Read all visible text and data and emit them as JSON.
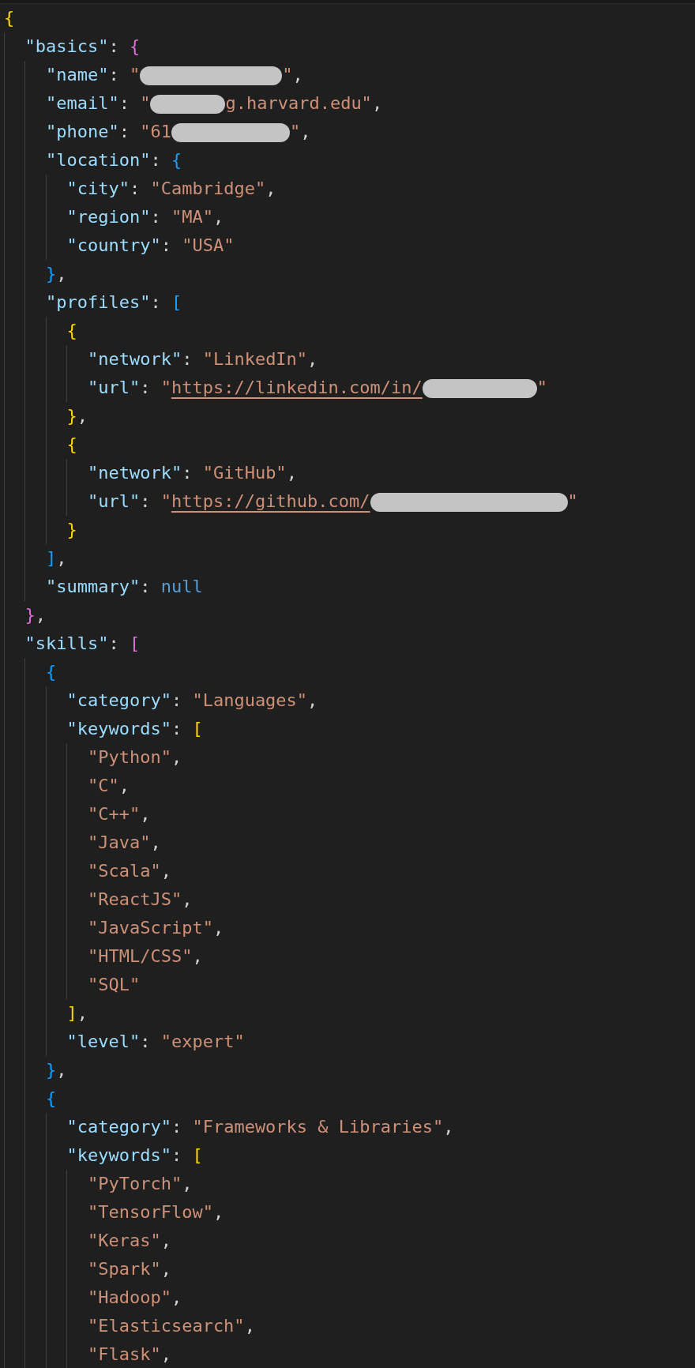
{
  "editor": {
    "lines": [
      {
        "tokens": [
          {
            "kind": "bracket",
            "text": "{",
            "color": "#ffd700"
          }
        ],
        "children": [
          {
            "tokens": [
              {
                "kind": "key",
                "text": "\"basics\""
              },
              {
                "kind": "punct",
                "text": ": "
              },
              {
                "kind": "bracket",
                "text": "{",
                "color": "#da70d6"
              }
            ],
            "children": [
              {
                "tokens": [
                  {
                    "kind": "key",
                    "text": "\"name\""
                  },
                  {
                    "kind": "punct",
                    "text": ": "
                  },
                  {
                    "kind": "string",
                    "text": "\""
                  },
                  {
                    "kind": "redacted"
                  },
                  {
                    "kind": "string",
                    "text": "\""
                  },
                  {
                    "kind": "punct",
                    "text": ","
                  }
                ]
              },
              {
                "tokens": [
                  {
                    "kind": "key",
                    "text": "\"email\""
                  },
                  {
                    "kind": "punct",
                    "text": ": "
                  },
                  {
                    "kind": "string",
                    "text": "\""
                  },
                  {
                    "kind": "redacted"
                  },
                  {
                    "kind": "string",
                    "text": "g.harvard.edu\""
                  },
                  {
                    "kind": "punct",
                    "text": ","
                  }
                ]
              },
              {
                "tokens": [
                  {
                    "kind": "key",
                    "text": "\"phone\""
                  },
                  {
                    "kind": "punct",
                    "text": ": "
                  },
                  {
                    "kind": "string",
                    "text": "\"61"
                  },
                  {
                    "kind": "redacted"
                  },
                  {
                    "kind": "string",
                    "text": "\""
                  },
                  {
                    "kind": "punct",
                    "text": ","
                  }
                ]
              },
              {
                "tokens": [
                  {
                    "kind": "key",
                    "text": "\"location\""
                  },
                  {
                    "kind": "punct",
                    "text": ": "
                  },
                  {
                    "kind": "bracket",
                    "text": "{",
                    "color": "#179fff"
                  }
                ],
                "children": [
                  {
                    "tokens": [
                      {
                        "kind": "key",
                        "text": "\"city\""
                      },
                      {
                        "kind": "punct",
                        "text": ": "
                      },
                      {
                        "kind": "string",
                        "text": "\"Cambridge\""
                      },
                      {
                        "kind": "punct",
                        "text": ","
                      }
                    ]
                  },
                  {
                    "tokens": [
                      {
                        "kind": "key",
                        "text": "\"region\""
                      },
                      {
                        "kind": "punct",
                        "text": ": "
                      },
                      {
                        "kind": "string",
                        "text": "\"MA\""
                      },
                      {
                        "kind": "punct",
                        "text": ","
                      }
                    ]
                  },
                  {
                    "tokens": [
                      {
                        "kind": "key",
                        "text": "\"country\""
                      },
                      {
                        "kind": "punct",
                        "text": ": "
                      },
                      {
                        "kind": "string",
                        "text": "\"USA\""
                      }
                    ]
                  }
                ]
              },
              {
                "tokens": [
                  {
                    "kind": "bracket",
                    "text": "}",
                    "color": "#179fff"
                  },
                  {
                    "kind": "punct",
                    "text": ","
                  }
                ]
              },
              {
                "tokens": [
                  {
                    "kind": "key",
                    "text": "\"profiles\""
                  },
                  {
                    "kind": "punct",
                    "text": ": "
                  },
                  {
                    "kind": "bracket",
                    "text": "[",
                    "color": "#179fff"
                  }
                ],
                "children": [
                  {
                    "tokens": [
                      {
                        "kind": "bracket",
                        "text": "{",
                        "color": "#ffd700"
                      }
                    ],
                    "children": [
                      {
                        "tokens": [
                          {
                            "kind": "key",
                            "text": "\"network\""
                          },
                          {
                            "kind": "punct",
                            "text": ": "
                          },
                          {
                            "kind": "string",
                            "text": "\"LinkedIn\""
                          },
                          {
                            "kind": "punct",
                            "text": ","
                          }
                        ]
                      },
                      {
                        "tokens": [
                          {
                            "kind": "key",
                            "text": "\"url\""
                          },
                          {
                            "kind": "punct",
                            "text": ": "
                          },
                          {
                            "kind": "string",
                            "text": "\""
                          },
                          {
                            "kind": "link",
                            "text": "https://linkedin.com/in/"
                          },
                          {
                            "kind": "redacted"
                          },
                          {
                            "kind": "string",
                            "text": "\""
                          }
                        ]
                      }
                    ]
                  },
                  {
                    "tokens": [
                      {
                        "kind": "bracket",
                        "text": "}",
                        "color": "#ffd700"
                      },
                      {
                        "kind": "punct",
                        "text": ","
                      }
                    ]
                  },
                  {
                    "tokens": [
                      {
                        "kind": "bracket",
                        "text": "{",
                        "color": "#ffd700"
                      }
                    ],
                    "children": [
                      {
                        "tokens": [
                          {
                            "kind": "key",
                            "text": "\"network\""
                          },
                          {
                            "kind": "punct",
                            "text": ": "
                          },
                          {
                            "kind": "string",
                            "text": "\"GitHub\""
                          },
                          {
                            "kind": "punct",
                            "text": ","
                          }
                        ]
                      },
                      {
                        "tokens": [
                          {
                            "kind": "key",
                            "text": "\"url\""
                          },
                          {
                            "kind": "punct",
                            "text": ": "
                          },
                          {
                            "kind": "string",
                            "text": "\""
                          },
                          {
                            "kind": "link",
                            "text": "https://github.com/"
                          },
                          {
                            "kind": "redacted"
                          },
                          {
                            "kind": "string",
                            "text": "\""
                          }
                        ]
                      }
                    ]
                  },
                  {
                    "tokens": [
                      {
                        "kind": "bracket",
                        "text": "}",
                        "color": "#ffd700"
                      }
                    ]
                  }
                ]
              },
              {
                "tokens": [
                  {
                    "kind": "bracket",
                    "text": "]",
                    "color": "#179fff"
                  },
                  {
                    "kind": "punct",
                    "text": ","
                  }
                ]
              },
              {
                "tokens": [
                  {
                    "kind": "key",
                    "text": "\"summary\""
                  },
                  {
                    "kind": "punct",
                    "text": ": "
                  },
                  {
                    "kind": "null",
                    "text": "null"
                  }
                ]
              }
            ]
          },
          {
            "tokens": [
              {
                "kind": "bracket",
                "text": "}",
                "color": "#da70d6"
              },
              {
                "kind": "punct",
                "text": ","
              }
            ]
          },
          {
            "tokens": [
              {
                "kind": "key",
                "text": "\"skills\""
              },
              {
                "kind": "punct",
                "text": ": "
              },
              {
                "kind": "bracket",
                "text": "[",
                "color": "#da70d6"
              }
            ],
            "children": [
              {
                "tokens": [
                  {
                    "kind": "bracket",
                    "text": "{",
                    "color": "#179fff"
                  }
                ],
                "children": [
                  {
                    "tokens": [
                      {
                        "kind": "key",
                        "text": "\"category\""
                      },
                      {
                        "kind": "punct",
                        "text": ": "
                      },
                      {
                        "kind": "string",
                        "text": "\"Languages\""
                      },
                      {
                        "kind": "punct",
                        "text": ","
                      }
                    ]
                  },
                  {
                    "tokens": [
                      {
                        "kind": "key",
                        "text": "\"keywords\""
                      },
                      {
                        "kind": "punct",
                        "text": ": "
                      },
                      {
                        "kind": "bracket",
                        "text": "[",
                        "color": "#ffd700"
                      }
                    ],
                    "children": [
                      {
                        "tokens": [
                          {
                            "kind": "string",
                            "text": "\"Python\""
                          },
                          {
                            "kind": "punct",
                            "text": ","
                          }
                        ]
                      },
                      {
                        "tokens": [
                          {
                            "kind": "string",
                            "text": "\"C\""
                          },
                          {
                            "kind": "punct",
                            "text": ","
                          }
                        ]
                      },
                      {
                        "tokens": [
                          {
                            "kind": "string",
                            "text": "\"C++\""
                          },
                          {
                            "kind": "punct",
                            "text": ","
                          }
                        ]
                      },
                      {
                        "tokens": [
                          {
                            "kind": "string",
                            "text": "\"Java\""
                          },
                          {
                            "kind": "punct",
                            "text": ","
                          }
                        ]
                      },
                      {
                        "tokens": [
                          {
                            "kind": "string",
                            "text": "\"Scala\""
                          },
                          {
                            "kind": "punct",
                            "text": ","
                          }
                        ]
                      },
                      {
                        "tokens": [
                          {
                            "kind": "string",
                            "text": "\"ReactJS\""
                          },
                          {
                            "kind": "punct",
                            "text": ","
                          }
                        ]
                      },
                      {
                        "tokens": [
                          {
                            "kind": "string",
                            "text": "\"JavaScript\""
                          },
                          {
                            "kind": "punct",
                            "text": ","
                          }
                        ]
                      },
                      {
                        "tokens": [
                          {
                            "kind": "string",
                            "text": "\"HTML/CSS\""
                          },
                          {
                            "kind": "punct",
                            "text": ","
                          }
                        ]
                      },
                      {
                        "tokens": [
                          {
                            "kind": "string",
                            "text": "\"SQL\""
                          }
                        ]
                      }
                    ]
                  },
                  {
                    "tokens": [
                      {
                        "kind": "bracket",
                        "text": "]",
                        "color": "#ffd700"
                      },
                      {
                        "kind": "punct",
                        "text": ","
                      }
                    ]
                  },
                  {
                    "tokens": [
                      {
                        "kind": "key",
                        "text": "\"level\""
                      },
                      {
                        "kind": "punct",
                        "text": ": "
                      },
                      {
                        "kind": "string",
                        "text": "\"expert\""
                      }
                    ]
                  }
                ]
              },
              {
                "tokens": [
                  {
                    "kind": "bracket",
                    "text": "}",
                    "color": "#179fff"
                  },
                  {
                    "kind": "punct",
                    "text": ","
                  }
                ]
              },
              {
                "tokens": [
                  {
                    "kind": "bracket",
                    "text": "{",
                    "color": "#179fff"
                  }
                ],
                "children": [
                  {
                    "tokens": [
                      {
                        "kind": "key",
                        "text": "\"category\""
                      },
                      {
                        "kind": "punct",
                        "text": ": "
                      },
                      {
                        "kind": "string",
                        "text": "\"Frameworks & Libraries\""
                      },
                      {
                        "kind": "punct",
                        "text": ","
                      }
                    ]
                  },
                  {
                    "tokens": [
                      {
                        "kind": "key",
                        "text": "\"keywords\""
                      },
                      {
                        "kind": "punct",
                        "text": ": "
                      },
                      {
                        "kind": "bracket",
                        "text": "[",
                        "color": "#ffd700"
                      }
                    ],
                    "children": [
                      {
                        "tokens": [
                          {
                            "kind": "string",
                            "text": "\"PyTorch\""
                          },
                          {
                            "kind": "punct",
                            "text": ","
                          }
                        ]
                      },
                      {
                        "tokens": [
                          {
                            "kind": "string",
                            "text": "\"TensorFlow\""
                          },
                          {
                            "kind": "punct",
                            "text": ","
                          }
                        ]
                      },
                      {
                        "tokens": [
                          {
                            "kind": "string",
                            "text": "\"Keras\""
                          },
                          {
                            "kind": "punct",
                            "text": ","
                          }
                        ]
                      },
                      {
                        "tokens": [
                          {
                            "kind": "string",
                            "text": "\"Spark\""
                          },
                          {
                            "kind": "punct",
                            "text": ","
                          }
                        ]
                      },
                      {
                        "tokens": [
                          {
                            "kind": "string",
                            "text": "\"Hadoop\""
                          },
                          {
                            "kind": "punct",
                            "text": ","
                          }
                        ]
                      },
                      {
                        "tokens": [
                          {
                            "kind": "string",
                            "text": "\"Elasticsearch\""
                          },
                          {
                            "kind": "punct",
                            "text": ","
                          }
                        ]
                      },
                      {
                        "tokens": [
                          {
                            "kind": "string",
                            "text": "\"Flask\""
                          },
                          {
                            "kind": "punct",
                            "text": ","
                          }
                        ]
                      }
                    ]
                  }
                ]
              }
            ]
          }
        ]
      }
    ]
  }
}
